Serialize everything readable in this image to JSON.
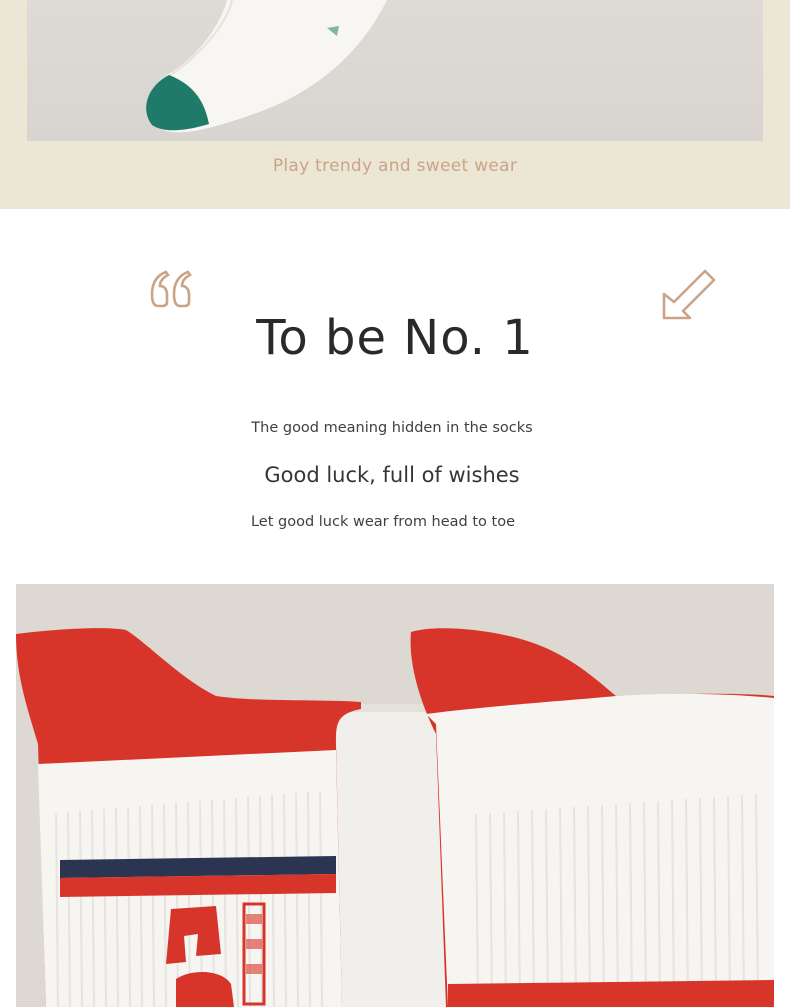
{
  "top_section": {
    "tagline": "Play trendy and sweet wear",
    "background_color": "#ece6d4",
    "accent_color": "#c9a488"
  },
  "icons": {
    "quote": "quote-icon",
    "arrow": "arrow-down-left-icon"
  },
  "heading": "To be No. 1",
  "lines": {
    "meaning": "The good meaning hidden in the socks",
    "luck": "Good luck, full of wishes",
    "wear": "Let good luck wear from head to toe"
  },
  "colors": {
    "sock_red": "#d8352a",
    "sock_white": "#f6f5f2",
    "sock_teal": "#1f7a6a",
    "sock_navy": "#2b3450"
  }
}
